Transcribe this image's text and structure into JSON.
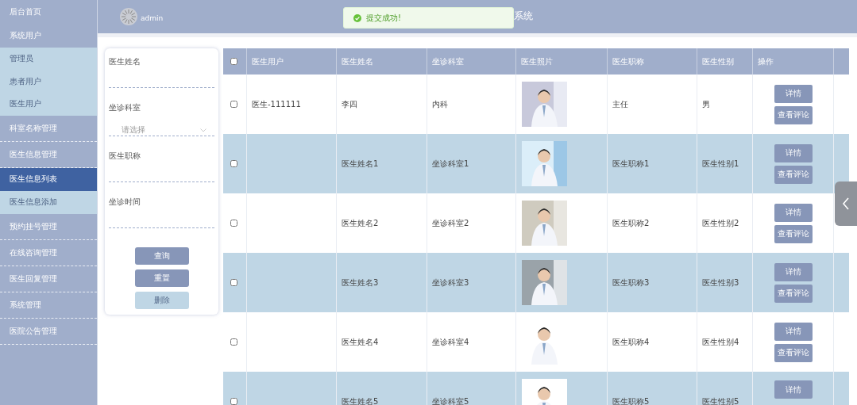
{
  "sidebar": {
    "items": [
      {
        "label": "后台首页",
        "selected": false
      },
      {
        "label": "系统用户",
        "selected": false,
        "children": [
          {
            "label": "管理员",
            "selected": false
          },
          {
            "label": "患者用户",
            "selected": false
          },
          {
            "label": "医生用户",
            "selected": false
          }
        ]
      },
      {
        "label": "科室名称管理",
        "selected": false
      },
      {
        "label": "医生信息管理",
        "selected": false,
        "children": [
          {
            "label": "医生信息列表",
            "selected": true
          },
          {
            "label": "医生信息添加",
            "selected": false
          }
        ]
      },
      {
        "label": "预约挂号管理",
        "selected": false
      },
      {
        "label": "在线咨询管理",
        "selected": false
      },
      {
        "label": "医生回复管理",
        "selected": false
      },
      {
        "label": "系统管理",
        "selected": false
      },
      {
        "label": "医院公告管理",
        "selected": false
      }
    ]
  },
  "header": {
    "user": "admin",
    "title": "系统"
  },
  "toast": {
    "message": "提交成功!"
  },
  "search": {
    "fields": [
      {
        "kind": "text",
        "label": "医生姓名"
      },
      {
        "kind": "select",
        "label": "坐诊科室",
        "placeholder": "请选择"
      },
      {
        "kind": "text",
        "label": "医生职称"
      },
      {
        "kind": "text",
        "label": "坐诊时间"
      }
    ],
    "buttons": [
      {
        "label": "查询",
        "disabled": false
      },
      {
        "label": "重置",
        "disabled": false
      },
      {
        "label": "删除",
        "disabled": true
      }
    ]
  },
  "table": {
    "all_checked": false,
    "columns": [
      "医生用户",
      "医生姓名",
      "坐诊科室",
      "医生照片",
      "医生职称",
      "医生性别",
      "操作"
    ],
    "rows": [
      {
        "checked": false,
        "user": "医生-111111",
        "name": "李四",
        "dept": "内科",
        "title": "主任",
        "gender": "男",
        "actions": [
          "详情",
          "查看评论"
        ]
      },
      {
        "checked": false,
        "user": "",
        "name": "医生姓名1",
        "dept": "坐诊科室1",
        "title": "医生职称1",
        "gender": "医生性别1",
        "actions": [
          "详情",
          "查看评论"
        ]
      },
      {
        "checked": false,
        "user": "",
        "name": "医生姓名2",
        "dept": "坐诊科室2",
        "title": "医生职称2",
        "gender": "医生性别2",
        "actions": [
          "详情",
          "查看评论"
        ]
      },
      {
        "checked": false,
        "user": "",
        "name": "医生姓名3",
        "dept": "坐诊科室3",
        "title": "医生职称3",
        "gender": "医生性别3",
        "actions": [
          "详情",
          "查看评论"
        ]
      },
      {
        "checked": false,
        "user": "",
        "name": "医生姓名4",
        "dept": "坐诊科室4",
        "title": "医生职称4",
        "gender": "医生性别4",
        "actions": [
          "详情",
          "查看评论"
        ]
      },
      {
        "checked": false,
        "user": "",
        "name": "医生姓名5",
        "dept": "坐诊科室5",
        "title": "医生职称5",
        "gender": "医生性别5",
        "actions": [
          "详情"
        ]
      }
    ]
  }
}
